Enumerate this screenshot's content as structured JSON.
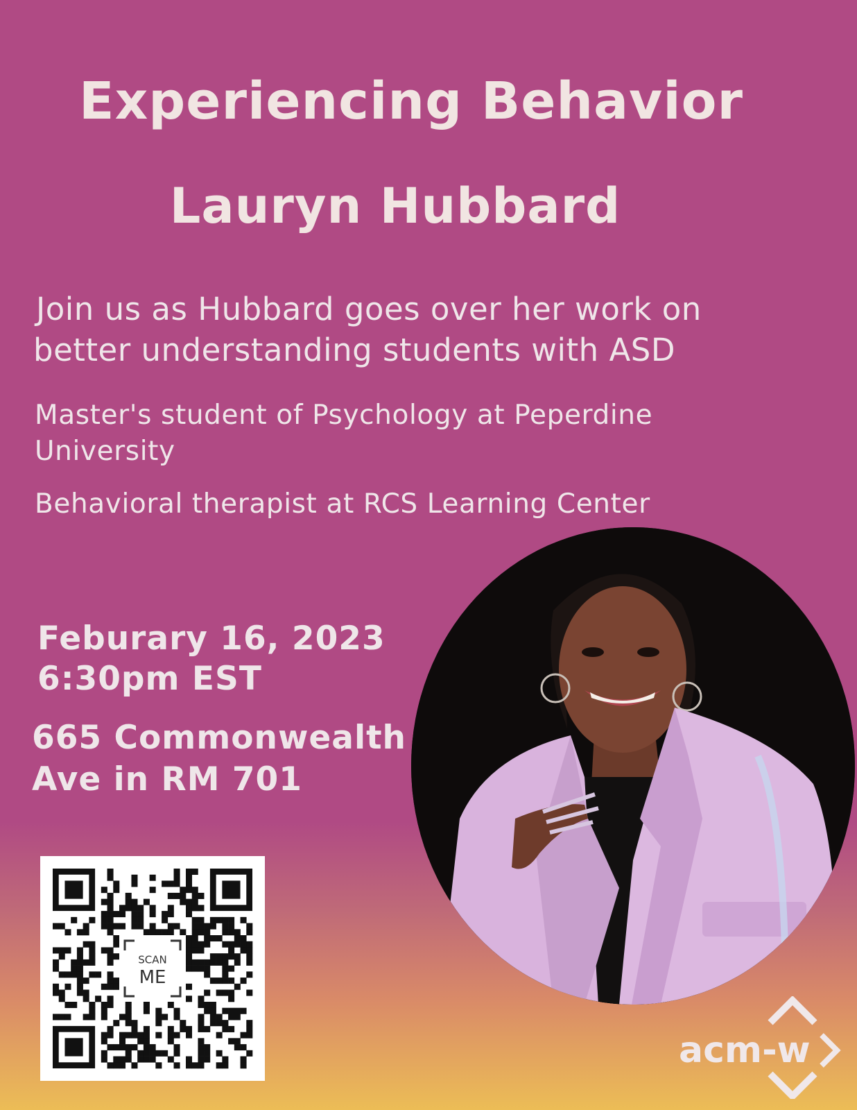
{
  "event": {
    "title": "Experiencing Behavior",
    "speaker": "Lauryn Hubbard",
    "description_line1": "Join us as Hubbard goes over her work on",
    "description_line2": "better understanding students with ASD",
    "role_line1": "Master's student of Psychology at Peperdine",
    "role_line2": "University",
    "role2": "Behavioral therapist  at RCS Learning Center",
    "date": "Feburary 16, 2023",
    "time": "6:30pm EST",
    "location_line1": "665 Commonwealth",
    "location_line2": "Ave in RM 701"
  },
  "qr": {
    "label_top": "SCAN",
    "label_bottom": "ME"
  },
  "logo": {
    "text": "acm-w"
  },
  "colors": {
    "background_top": "#b04a84",
    "background_bottom": "#ecbd56",
    "text": "#efe6e9",
    "jacket": "#d9b3dd"
  }
}
